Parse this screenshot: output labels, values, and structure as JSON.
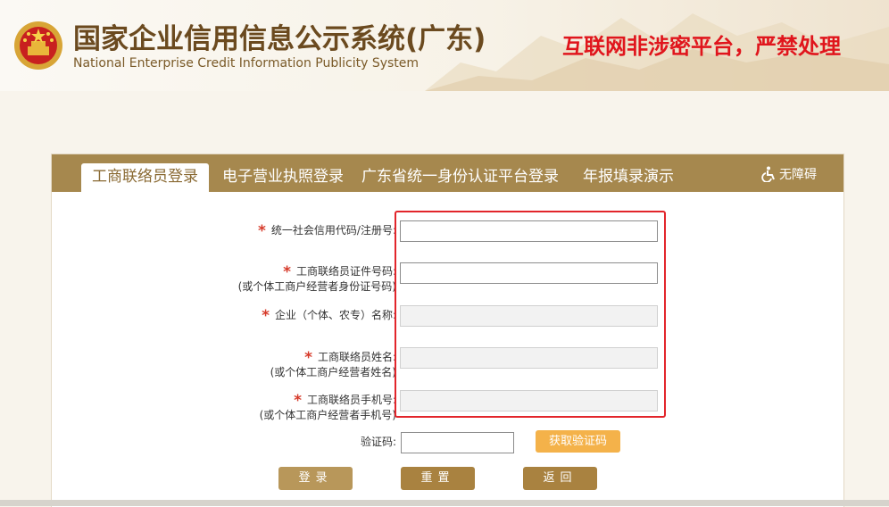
{
  "header": {
    "title_cn": "国家企业信用信息公示系统(广东)",
    "title_en": "National Enterprise Credit Information Publicity System",
    "notice": "互联网非涉密平台，严禁处理"
  },
  "tabs": [
    {
      "label": "工商联络员登录",
      "active": true
    },
    {
      "label": "电子营业执照登录",
      "active": false
    },
    {
      "label": "广东省统一身份认证平台登录",
      "active": false
    },
    {
      "label": "年报填录演示",
      "active": false
    }
  ],
  "accessibility_label": "无障碍",
  "form": {
    "credit_code": {
      "label": "统一社会信用代码/注册号:",
      "value": "",
      "required": true
    },
    "id_number": {
      "label_line1": "工商联络员证件号码:",
      "label_line2": "(或个体工商户经营者身份证号码)",
      "value": "",
      "required": true
    },
    "company_name": {
      "label": "企业（个体、农专）名称:",
      "value": "",
      "required": true
    },
    "contact_name": {
      "label_line1": "工商联络员姓名:",
      "label_line2": "(或个体工商户经营者姓名)",
      "value": "",
      "required": true
    },
    "contact_phone": {
      "label_line1": "工商联络员手机号:",
      "label_line2": "(或个体工商户经营者手机号)",
      "value": "",
      "required": true
    },
    "captcha": {
      "label": "验证码:",
      "value": "",
      "button": "获取验证码"
    }
  },
  "buttons": {
    "login": "登录",
    "reset": "重置",
    "back": "返回"
  },
  "colors": {
    "tabbar": "#a6884e",
    "notice": "#e0151c",
    "highlight_box": "#e2252b",
    "captcha_button": "#f4b24a"
  }
}
